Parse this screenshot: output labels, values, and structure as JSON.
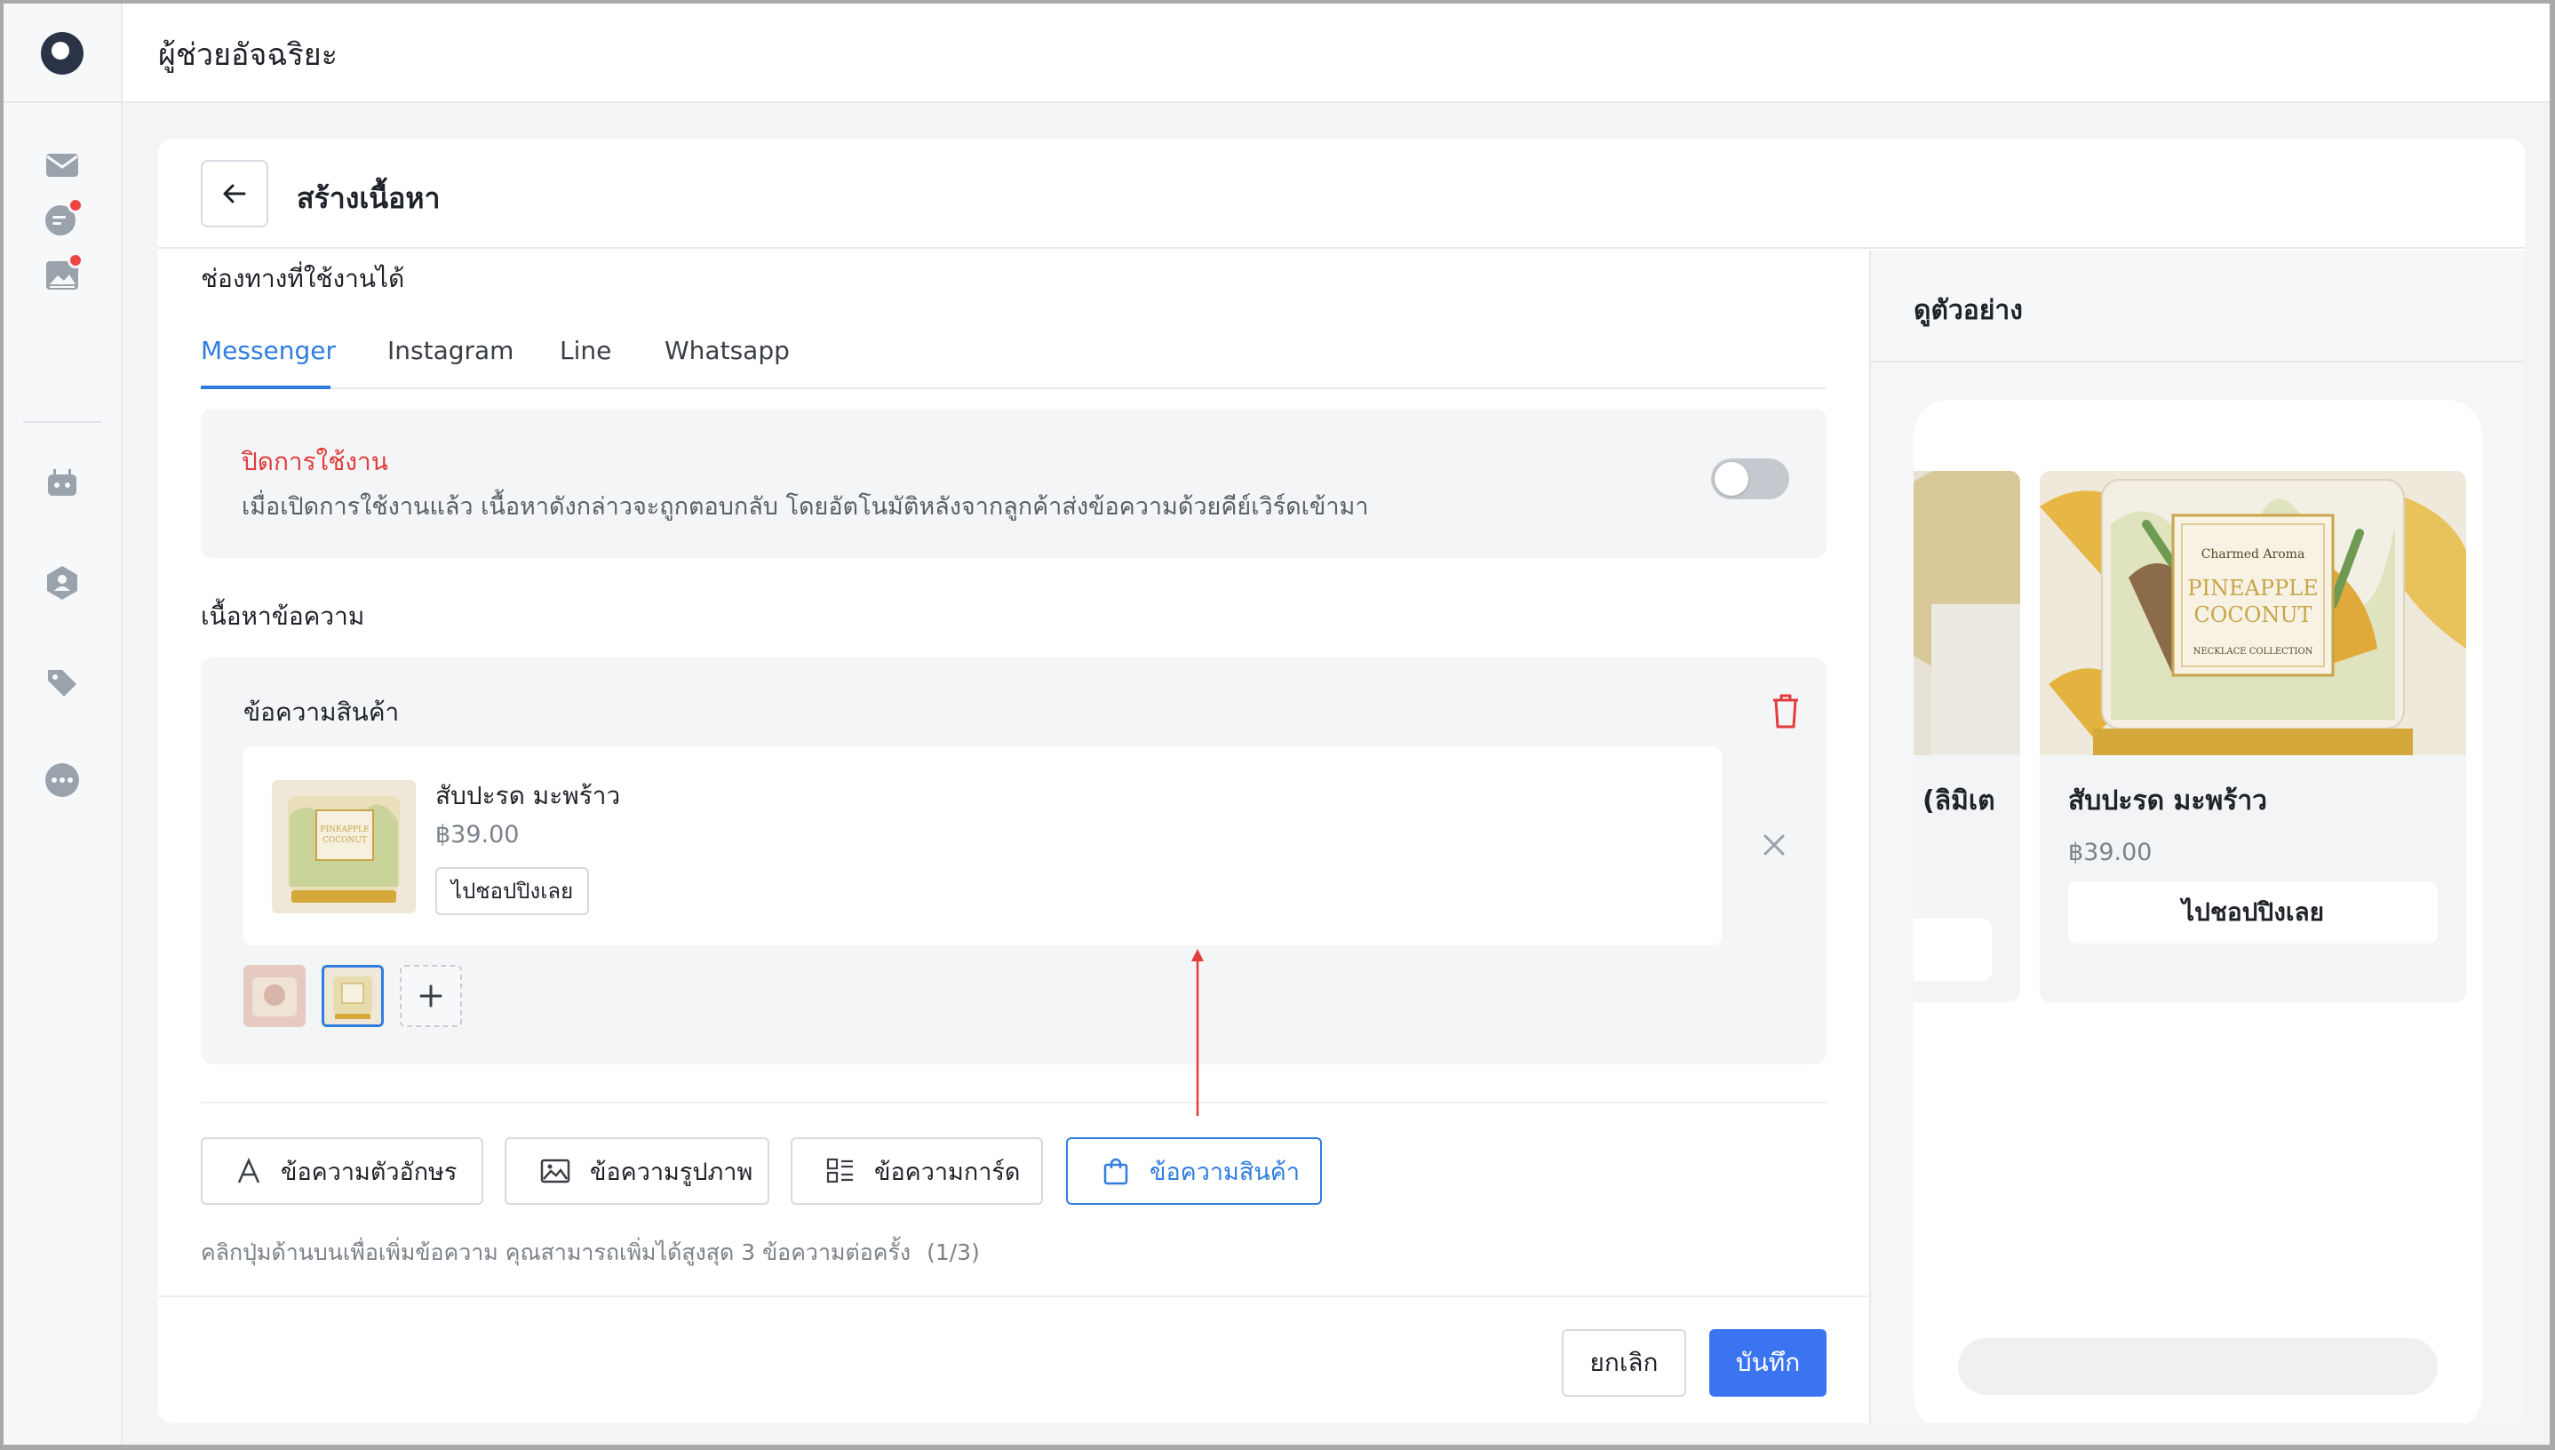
{
  "app": {
    "title": "ผู้ช่วยอัจฉริยะ"
  },
  "sidebar": {
    "items": [
      {
        "icon": "mail-icon"
      },
      {
        "icon": "chat-icon",
        "badge": true
      },
      {
        "icon": "image-post-icon",
        "badge": true
      },
      {
        "icon": "bot-icon"
      },
      {
        "icon": "user-shield-icon"
      },
      {
        "icon": "tags-icon"
      },
      {
        "icon": "more-icon"
      }
    ]
  },
  "page": {
    "title": "สร้างเนื้อหา",
    "channels_label": "ช่องทางที่ใช้งานได้",
    "tabs": [
      {
        "label": "Messenger",
        "active": true
      },
      {
        "label": "Instagram"
      },
      {
        "label": "Line"
      },
      {
        "label": "Whatsapp"
      }
    ],
    "toggle": {
      "title": "ปิดการใช้งาน",
      "description": "เมื่อเปิดการใช้งานแล้ว เนื้อหาดังกล่าวจะถูกตอบกลับ โดยอัตโนมัติหลังจากลูกค้าส่งข้อความด้วยคีย์เวิร์ดเข้ามา",
      "enabled": false
    },
    "content_label": "เนื้อหาข้อความ",
    "message_block": {
      "title": "ข้อความสินค้า",
      "product": {
        "name": "สับปะรด มะพร้าว",
        "price": "฿39.00",
        "button": "ไปชอปปิงเลย"
      },
      "thumbnails": 2,
      "selected_thumbnail": 2
    },
    "message_types": [
      {
        "label": "ข้อความตัวอักษร",
        "icon": "text-icon"
      },
      {
        "label": "ข้อความรูปภาพ",
        "icon": "image-icon"
      },
      {
        "label": "ข้อความการ์ด",
        "icon": "card-list-icon"
      },
      {
        "label": "ข้อความสินค้า",
        "icon": "shopping-bag-icon",
        "active": true
      }
    ],
    "hint": "คลิกปุ่มด้านบนเพื่อเพิ่มข้อความ คุณสามารถเพิ่มได้สูงสุด 3 ข้อความต่อครั้ง",
    "hint_count": "(1/3)",
    "cancel_label": "ยกเลิก",
    "save_label": "บันทึก"
  },
  "preview": {
    "title": "ดูตัวอย่าง",
    "cards": [
      {
        "name": "(ลิมิเต",
        "partial": true
      },
      {
        "name": "สับปะรด มะพร้าว",
        "price": "฿39.00",
        "button": "ไปชอปปิงเลย"
      }
    ],
    "candle_label": {
      "brand": "Charmed Aroma",
      "line1": "PINEAPPLE",
      "line2": "COCONUT",
      "collection": "NECKLACE COLLECTION"
    }
  },
  "colors": {
    "accent": "#2f7de1",
    "primary_button": "#3b74f0",
    "danger": "#e23c3c",
    "badge": "#ef4444"
  }
}
